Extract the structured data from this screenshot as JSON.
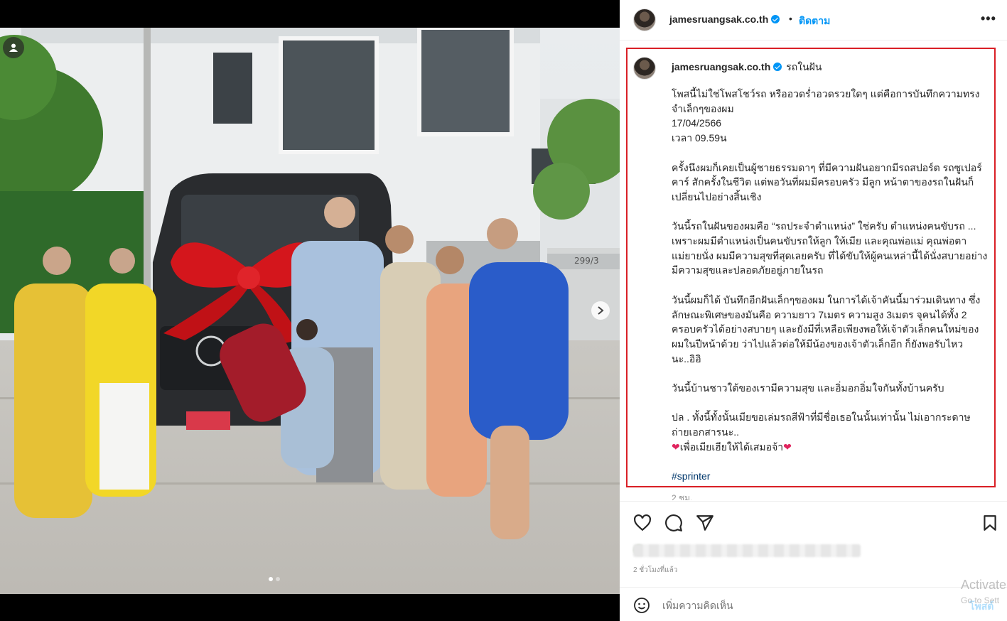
{
  "post": {
    "username": "jamesruangsak.co.th",
    "follow_label": "ติดตาม",
    "separator": "•",
    "more_label": "•••"
  },
  "caption": {
    "username": "jamesruangsak.co.th",
    "first_line": "รถในฝัน",
    "paragraphs": [
      "โพสนี้ไม่ใช่โพสโชว์รถ หรืออวดร่ำอวดรวยใดๆ แต่คือการบันทึกความทรงจำเล็กๆของผม",
      "17/04/2566",
      "เวลา 09.59น",
      "ครั้งนึงผมก็เคยเป็นผู้ชายธรรมดาๆ ที่มีความฝันอยากมีรถสปอร์ต รถซูเปอร์คาร์ สักครั้งในชีวิต แต่พอวันที่ผมมีครอบครัว มีลูก หน้าตาของรถในฝันก็เปลี่ยนไปอย่างสิ้นเชิง",
      "วันนี้รถในฝันของผมคือ “รถประจำตำแหน่ง” ใช่ครับ ตำแหน่งคนขับรถ ... เพราะผมมีตำแหน่งเป็นคนขับรถให้ลูก ให้เมีย และคุณพ่อแม่ คุณพ่อตาแม่ยายนั่ง ผมมีความสุขที่สุดเลยครับ ที่ได้ขับให้ผู้คนเหล่านี้ได้นั่งสบายอย่างมีความสุขและปลอดภัยอยู่ภายในรถ",
      "วันนี้ผมก็ได้ บันทึกอีกฝันเล็กๆของผม ในการได้เจ้าคันนี้มาร่วมเดินทาง ซึ่งลักษณะพิเศษของมันคือ ความยาว 7เมตร ความสูง 3เมตร จุคนได้ทั้ง 2 ครอบครัวได้อย่างสบายๆ และยังมีที่เหลือเพียงพอให้เจ้าตัวเล็กคนใหม่ของผมในปีหน้าด้วย ว่าไปแล้วต่อให้มีน้องของเจ้าตัวเล็กอีก ก็ยังพอรับไหวนะ..อิอิ",
      "วันนี้บ้านชาวใต้ของเรามีความสุข และอิ่มอกอิ่มใจกันทั้งบ้านครับ",
      "ปล . ทั้งนี้ทั้งนั้นเมียขอเล่มรถสีฟ้าที่มีชื่อเธอในนั้นเท่านั้น ไม่เอากระดาษถ่ายเอกสารนะ..",
      "เพื่อเมียเฮียให้ได้เสมอจ้า",
      "#sprinter"
    ],
    "heart": "❤",
    "age": "2 ชม."
  },
  "actions": {
    "like_icon": "heart-outline-icon",
    "comment_icon": "comment-bubble-icon",
    "share_icon": "paper-plane-icon",
    "save_icon": "bookmark-icon"
  },
  "timestamp": "2 ชั่วโมงที่แล้ว",
  "comment": {
    "placeholder": "เพิ่มความคิดเห็น",
    "post_label": "โพสต์"
  },
  "os_watermark": {
    "line1": "Activate",
    "line2": "Go to Sett"
  },
  "photo": {
    "plate_text": "299/3"
  }
}
